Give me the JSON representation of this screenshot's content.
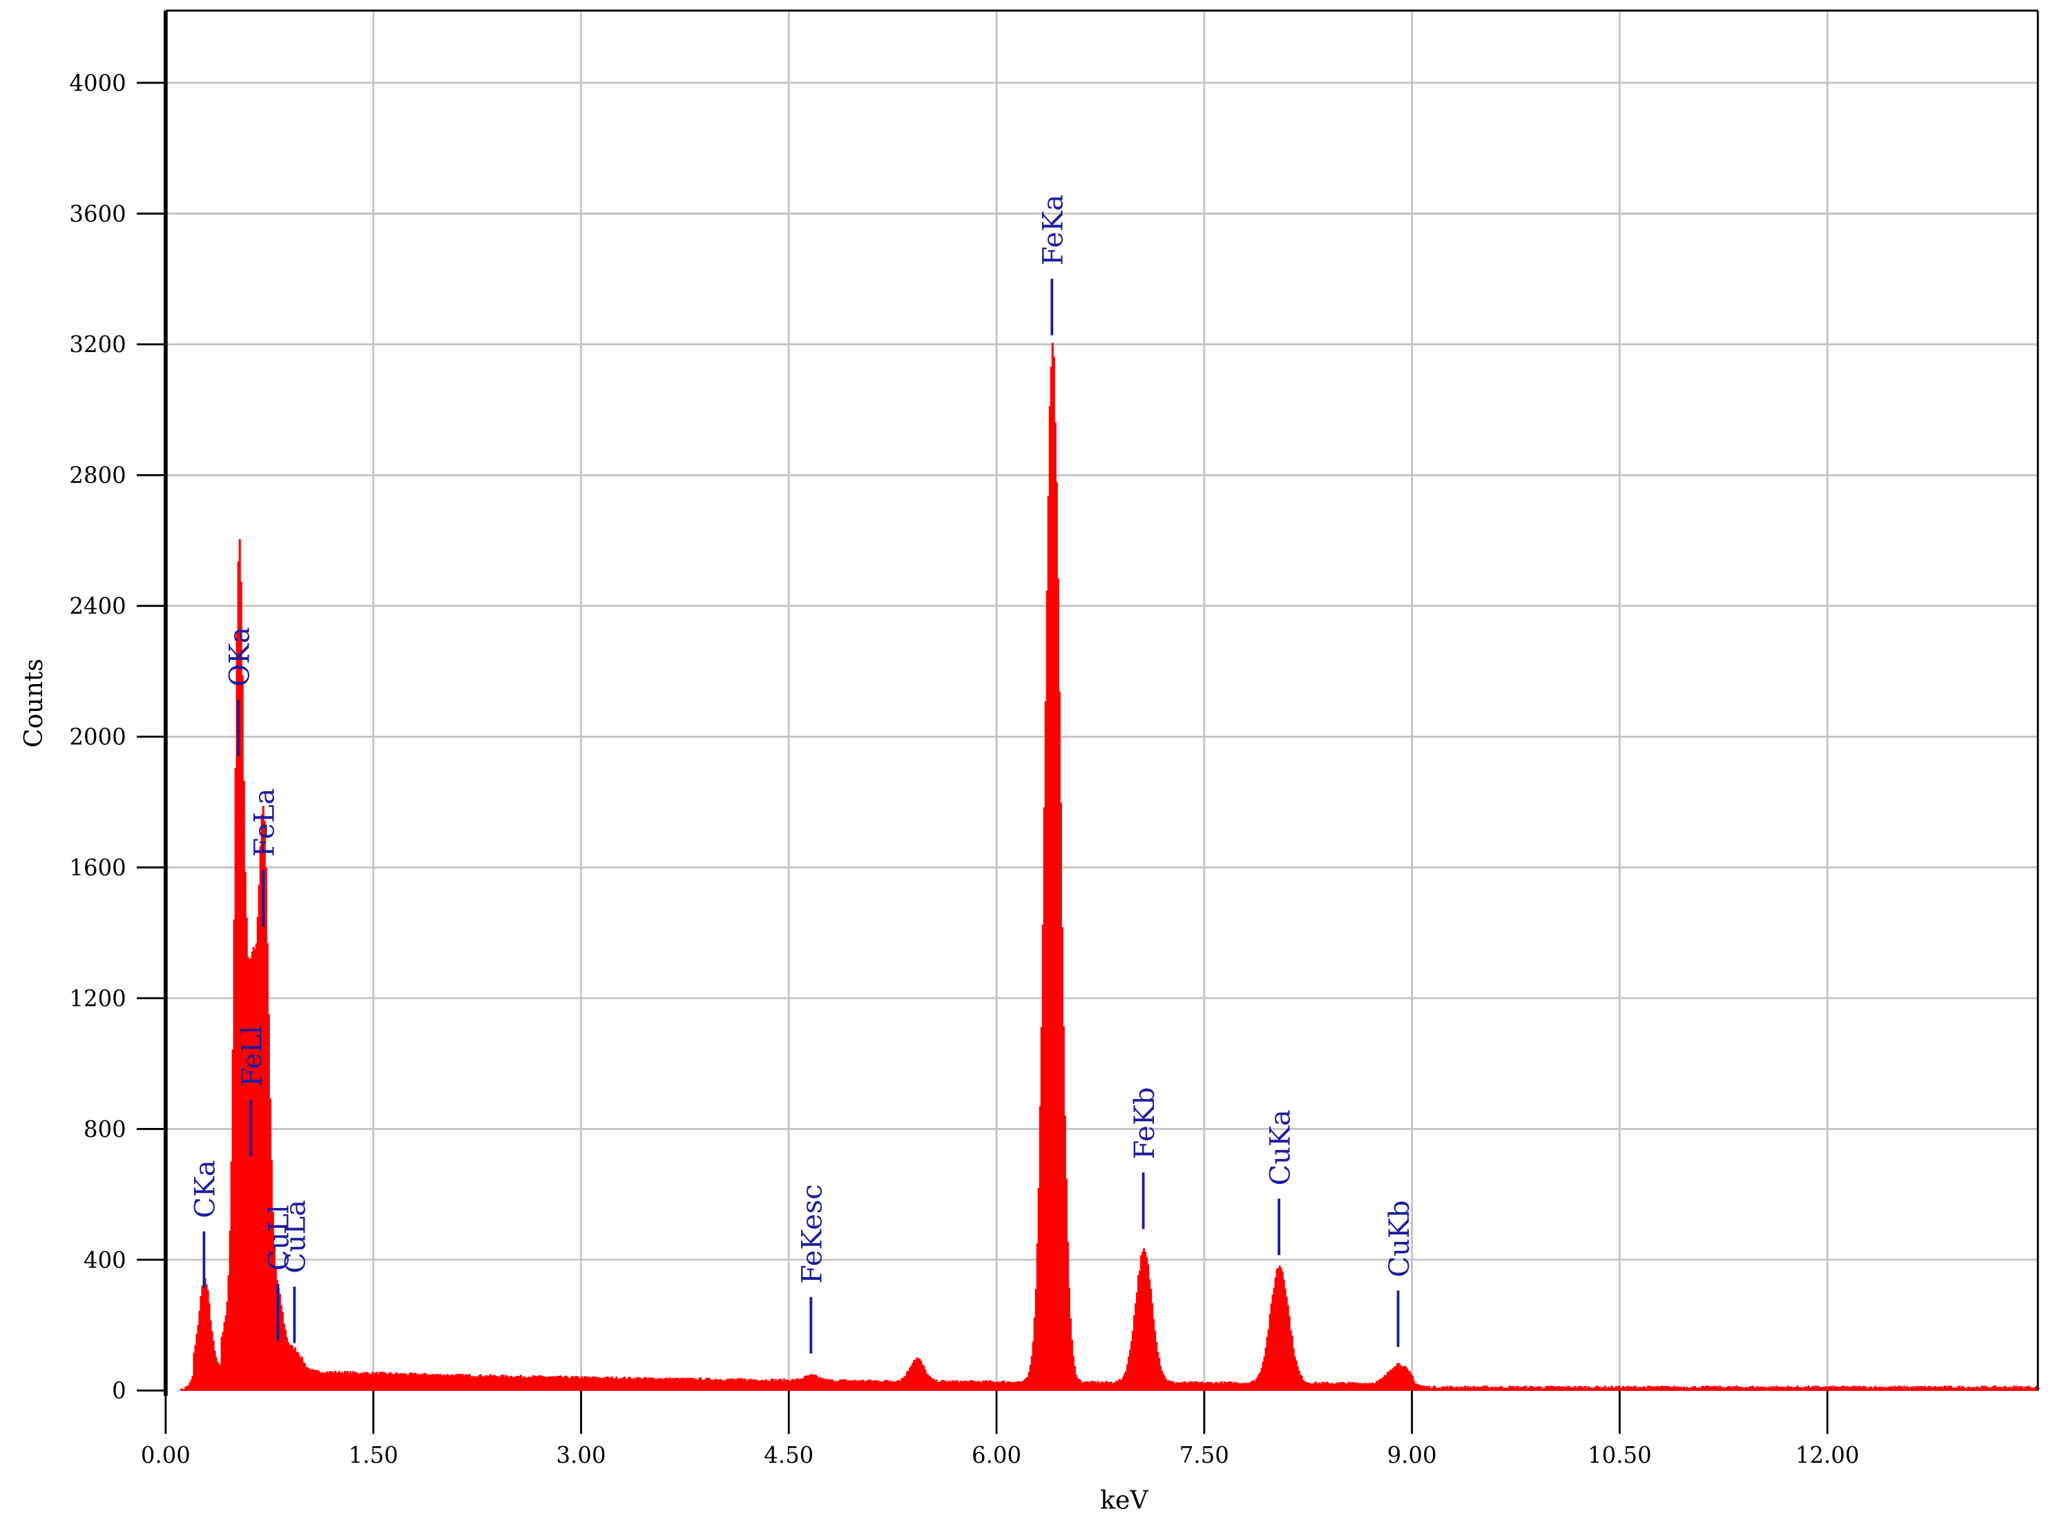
{
  "chart_data": {
    "type": "area",
    "title": "",
    "xlabel": "keV",
    "ylabel": "Counts",
    "xlim": [
      0,
      13.52
    ],
    "ylim": [
      0,
      4000
    ],
    "grid": true,
    "x_ticks": [
      "0.00",
      "1.50",
      "3.00",
      "4.50",
      "6.00",
      "7.50",
      "9.00",
      "10.50",
      "12.00"
    ],
    "x_tick_values": [
      0,
      1.5,
      3,
      4.5,
      6,
      7.5,
      9,
      10.5,
      12
    ],
    "y_ticks": [
      "0",
      "400",
      "800",
      "1200",
      "1600",
      "2000",
      "2400",
      "2800",
      "3200",
      "3600",
      "4000"
    ],
    "y_tick_values": [
      0,
      400,
      800,
      1200,
      1600,
      2000,
      2400,
      2800,
      3200,
      3600,
      4000
    ],
    "series_color": "#ff0000",
    "label_color": "#1c1ca0",
    "peaks": [
      {
        "label": "CKa",
        "energy": 0.277,
        "counts": 270,
        "sigma": 0.04,
        "marker_counts": 314
      },
      {
        "label": "OKa",
        "energy": 0.525,
        "counts": 2100,
        "sigma": 0.03,
        "marker_counts": 1940
      },
      {
        "label": "FeLl",
        "energy": 0.615,
        "counts": 700,
        "sigma": 0.04,
        "marker_counts": 716
      },
      {
        "label": "FeLa",
        "energy": 0.705,
        "counts": 1340,
        "sigma": 0.035,
        "marker_counts": 1419
      },
      {
        "label": "CuLl",
        "energy": 0.811,
        "counts": 150,
        "sigma": 0.04,
        "marker_counts": 153
      },
      {
        "label": "CuLa",
        "energy": 0.93,
        "counts": 60,
        "sigma": 0.05,
        "marker_counts": 145
      },
      {
        "label": "FeKesc",
        "energy": 4.66,
        "counts": 15,
        "sigma": 0.05,
        "marker_counts": 113
      },
      {
        "label": "",
        "energy": 5.42,
        "counts": 70,
        "sigma": 0.05,
        "marker_counts": null
      },
      {
        "label": "FeKa",
        "energy": 6.4,
        "counts": 3170,
        "sigma": 0.055,
        "marker_counts": 3228
      },
      {
        "label": "FeKb",
        "energy": 7.06,
        "counts": 400,
        "sigma": 0.06,
        "marker_counts": 494
      },
      {
        "label": "CuKa",
        "energy": 8.04,
        "counts": 360,
        "sigma": 0.065,
        "marker_counts": 414
      },
      {
        "label": "CuKb",
        "energy": 8.9,
        "counts": 60,
        "sigma": 0.07,
        "marker_counts": 133
      }
    ]
  }
}
